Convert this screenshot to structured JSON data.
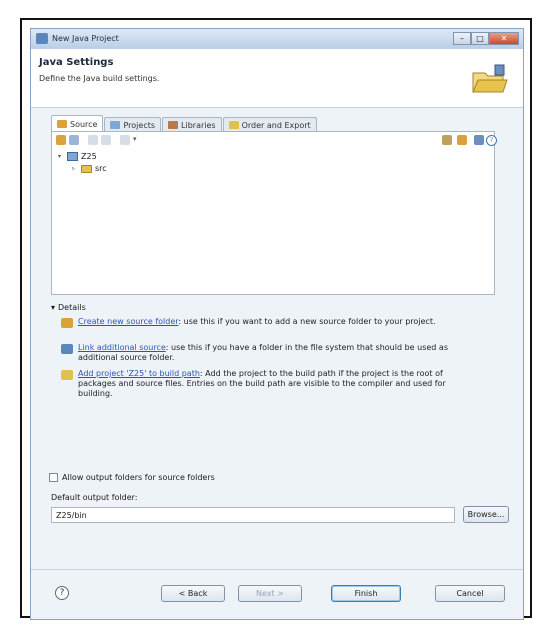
{
  "window": {
    "title": "New Java Project",
    "min": "–",
    "max": "□",
    "close": "✕"
  },
  "header": {
    "title": "Java Settings",
    "subtitle": "Define the Java build settings."
  },
  "tabs": [
    {
      "label": "Source",
      "color": "#d9a33a"
    },
    {
      "label": "Projects",
      "color": "#7ea6d6"
    },
    {
      "label": "Libraries",
      "color": "#b87a4a"
    },
    {
      "label": "Order and Export",
      "color": "#e2c04d"
    }
  ],
  "tree": {
    "project": "Z25",
    "folder": "src",
    "expanded": "▾",
    "collapsed": "▹"
  },
  "details": {
    "heading": "Details",
    "toggle": "▾",
    "items": [
      {
        "link": "Create new source folder",
        "text": ": use this if you want to add a new source folder to your project.",
        "color": "#d9a33a"
      },
      {
        "link": "Link additional source",
        "text": ": use this if you have a folder in the file system that should be used as additional source folder.",
        "color": "#5a86bd"
      },
      {
        "link": "Add project 'Z25' to build path",
        "text": ": Add the project to the build path if the project is the root of packages and source files. Entries on the build path are visible to the compiler and used for building.",
        "color": "#e2c04d"
      }
    ]
  },
  "options": {
    "allow_output": "Allow output folders for source folders",
    "output_label": "Default output folder:",
    "output_value": "Z25/bin",
    "browse": "Browse..."
  },
  "buttons": {
    "help": "?",
    "back": "< Back",
    "next": "Next >",
    "finish": "Finish",
    "cancel": "Cancel"
  }
}
